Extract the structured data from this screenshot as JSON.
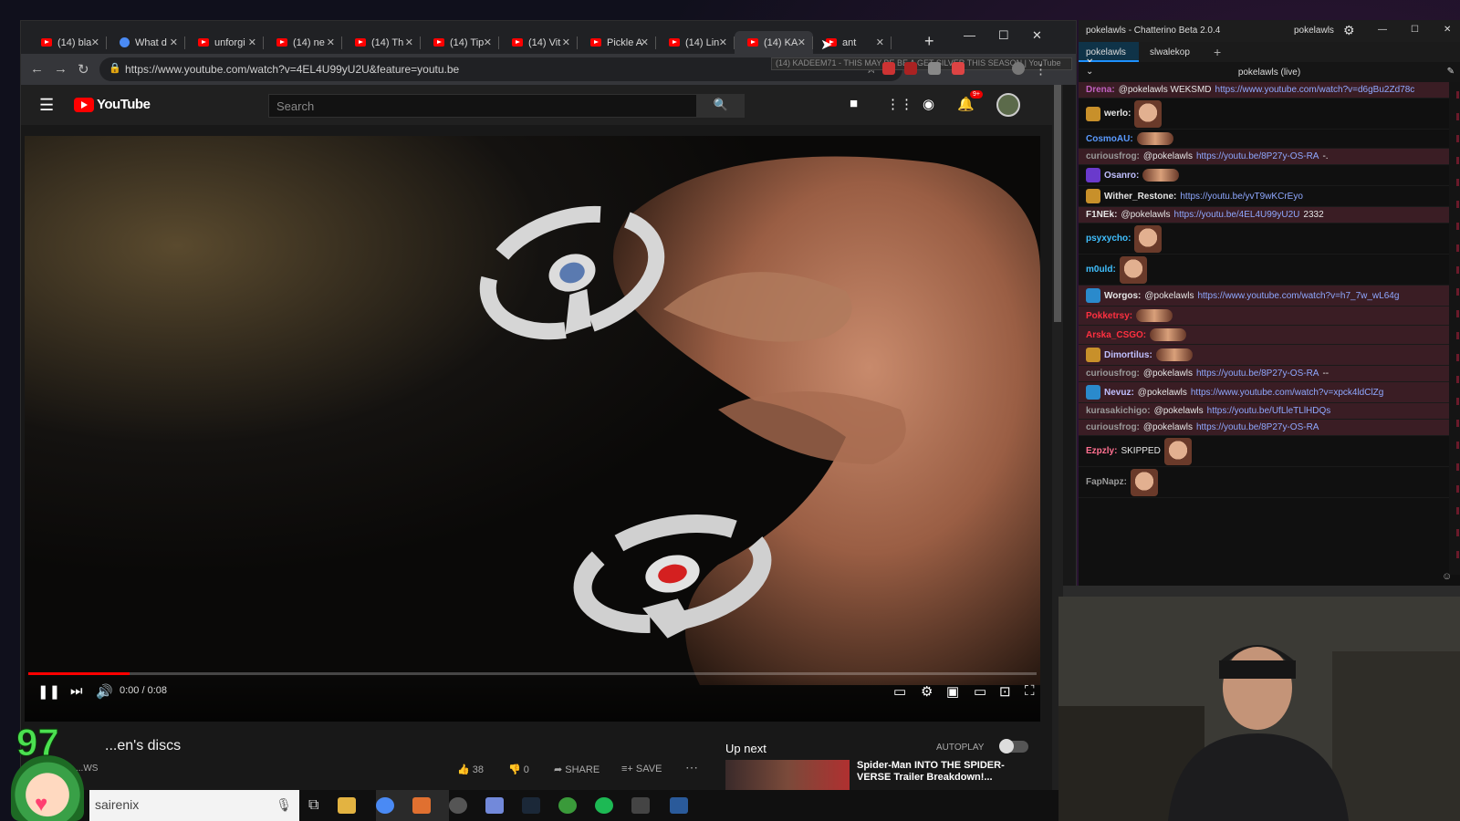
{
  "browser": {
    "tabs": [
      {
        "label": "(14) bla",
        "favicon": "youtube"
      },
      {
        "label": "What d",
        "favicon": "google"
      },
      {
        "label": "unforgi",
        "favicon": "youtube"
      },
      {
        "label": "(14) ne",
        "favicon": "youtube"
      },
      {
        "label": "(14) Th",
        "favicon": "youtube"
      },
      {
        "label": "(14) Tip",
        "favicon": "youtube"
      },
      {
        "label": "(14) Vit",
        "favicon": "youtube"
      },
      {
        "label": "Pickle A",
        "favicon": "youtube"
      },
      {
        "label": "(14) Lin",
        "favicon": "youtube"
      },
      {
        "label": "(14) KA",
        "favicon": "youtube",
        "active": true
      },
      {
        "label": "ant",
        "favicon": "youtube"
      }
    ],
    "url": "https://www.youtube.com/watch?v=4EL4U99yU2U&feature=youtu.be",
    "tooltip": "(14) KADEEM71 - THIS MAY BE BE A GET SILVER THIS SEASON | YouTube"
  },
  "youtube": {
    "logo": "YouTube",
    "search_placeholder": "Search",
    "notification_count": "9+",
    "video_time": "0:00 / 0:08",
    "progress": 0.1,
    "video_title": "...en's discs",
    "channel": "...WS",
    "likes": "38",
    "dislikes": "0",
    "share_label": "SHARE",
    "save_label": "SAVE",
    "up_next_label": "Up next",
    "autoplay_label": "AUTOPLAY",
    "up_next_title": "Spider-Man INTO THE SPIDER-VERSE Trailer Breakdown!..."
  },
  "chatterino": {
    "window_title": "pokelawls - Chatterino Beta 2.0.4",
    "user": "pokelawls",
    "tabs": [
      "pokelawls",
      "slwalekop"
    ],
    "channel_header": "pokelawls (live)",
    "messages": [
      {
        "name": "Drena:",
        "color": "#c060c0",
        "text": "@pokelawls WEKSMD",
        "link": "https://www.youtube.com/watch?v=d6gBu2Zd78c",
        "hl": true
      },
      {
        "name": "werlo:",
        "color": "#e6e6e6",
        "text": "",
        "link": "",
        "emote": "big",
        "badge": "gold"
      },
      {
        "name": "CosmoAU:",
        "color": "#5a9aff",
        "text": "",
        "link": "",
        "emote": "small"
      },
      {
        "name": "curiousfrog:",
        "color": "#9a9a9a",
        "text": "@pokelawls",
        "link": "https://youtu.be/8P27y-OS-RA",
        "suffix": "-.",
        "hl": true
      },
      {
        "name": "Osanro:",
        "color": "#c0c0ff",
        "text": "",
        "link": "",
        "emote": "small",
        "badge": "purple"
      },
      {
        "name": "Wither_Restone:",
        "color": "#e6e6e6",
        "text": "",
        "link": "https://youtu.be/yvT9wKCrEyo",
        "badge": "gold"
      },
      {
        "name": "F1NEk:",
        "color": "#e6e6e6",
        "text": "@pokelawls",
        "link": "https://youtu.be/4EL4U99yU2U",
        "suffix": "2332",
        "hl": true
      },
      {
        "name": "psyxycho:",
        "color": "#40c0ff",
        "text": "",
        "link": "",
        "emote": "big"
      },
      {
        "name": "m0uld:",
        "color": "#40c0ff",
        "text": "",
        "link": "",
        "emote": "big"
      },
      {
        "name": "Worgos:",
        "color": "#e6e6e6",
        "text": "@pokelawls",
        "link": "https://www.youtube.com/watch?v=h7_7w_wL64g",
        "badge": "blue",
        "hl": true
      },
      {
        "name": "Pokketrsy:",
        "color": "#ff3040",
        "text": "",
        "link": "",
        "emote": "small",
        "hl": true
      },
      {
        "name": "Arska_CSGO:",
        "color": "#ff3040",
        "text": "",
        "link": "",
        "emote": "small",
        "hl": true
      },
      {
        "name": "Dimortilus:",
        "color": "#c0c0ff",
        "text": "",
        "link": "",
        "emote": "small",
        "badge": "gold",
        "hl": true
      },
      {
        "name": "curiousfrog:",
        "color": "#9a9a9a",
        "text": "@pokelawls",
        "link": "https://youtu.be/8P27y-OS-RA",
        "suffix": "--",
        "hl": true
      },
      {
        "name": "Nevuz:",
        "color": "#c0c0ff",
        "text": "@pokelawls",
        "link": "https://www.youtube.com/watch?v=xpck4ldClZg",
        "badge": "blue",
        "hl": true
      },
      {
        "name": "kurasakichigo:",
        "color": "#9a9a9a",
        "text": "@pokelawls",
        "link": "https://youtu.be/UfLleTLlHDQs",
        "hl": true
      },
      {
        "name": "curiousfrog:",
        "color": "#9a9a9a",
        "text": "@pokelawls",
        "link": "https://youtu.be/8P27y-OS-RA",
        "hl": true
      },
      {
        "name": "Ezpzly:",
        "color": "#ff7090",
        "text": "SKIPPED",
        "link": "",
        "emote": "big"
      },
      {
        "name": "FapNapz:",
        "color": "#9a9a9a",
        "text": "",
        "link": "",
        "emote": "big"
      }
    ]
  },
  "taskbar": {
    "search_text": "sairenix"
  },
  "overlay": {
    "number": "97"
  },
  "colors": {
    "youtube_red": "#ff0000",
    "chatterino_tab_active": "#0f3348",
    "highlight_row": "#3a1d24"
  }
}
